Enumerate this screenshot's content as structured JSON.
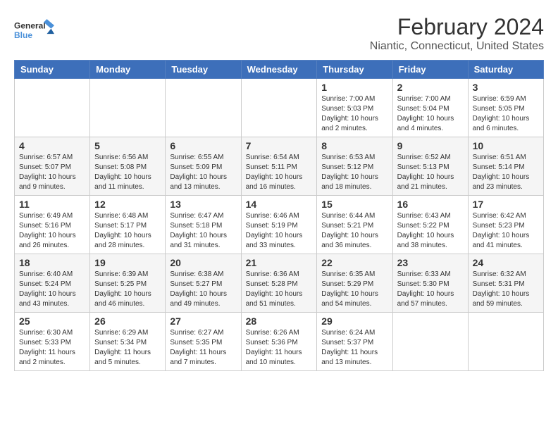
{
  "logo": {
    "line1": "General",
    "line2": "Blue"
  },
  "title": "February 2024",
  "subtitle": "Niantic, Connecticut, United States",
  "days_of_week": [
    "Sunday",
    "Monday",
    "Tuesday",
    "Wednesday",
    "Thursday",
    "Friday",
    "Saturday"
  ],
  "weeks": [
    [
      {
        "day": "",
        "info": ""
      },
      {
        "day": "",
        "info": ""
      },
      {
        "day": "",
        "info": ""
      },
      {
        "day": "",
        "info": ""
      },
      {
        "day": "1",
        "info": "Sunrise: 7:00 AM\nSunset: 5:03 PM\nDaylight: 10 hours\nand 2 minutes."
      },
      {
        "day": "2",
        "info": "Sunrise: 7:00 AM\nSunset: 5:04 PM\nDaylight: 10 hours\nand 4 minutes."
      },
      {
        "day": "3",
        "info": "Sunrise: 6:59 AM\nSunset: 5:05 PM\nDaylight: 10 hours\nand 6 minutes."
      }
    ],
    [
      {
        "day": "4",
        "info": "Sunrise: 6:57 AM\nSunset: 5:07 PM\nDaylight: 10 hours\nand 9 minutes."
      },
      {
        "day": "5",
        "info": "Sunrise: 6:56 AM\nSunset: 5:08 PM\nDaylight: 10 hours\nand 11 minutes."
      },
      {
        "day": "6",
        "info": "Sunrise: 6:55 AM\nSunset: 5:09 PM\nDaylight: 10 hours\nand 13 minutes."
      },
      {
        "day": "7",
        "info": "Sunrise: 6:54 AM\nSunset: 5:11 PM\nDaylight: 10 hours\nand 16 minutes."
      },
      {
        "day": "8",
        "info": "Sunrise: 6:53 AM\nSunset: 5:12 PM\nDaylight: 10 hours\nand 18 minutes."
      },
      {
        "day": "9",
        "info": "Sunrise: 6:52 AM\nSunset: 5:13 PM\nDaylight: 10 hours\nand 21 minutes."
      },
      {
        "day": "10",
        "info": "Sunrise: 6:51 AM\nSunset: 5:14 PM\nDaylight: 10 hours\nand 23 minutes."
      }
    ],
    [
      {
        "day": "11",
        "info": "Sunrise: 6:49 AM\nSunset: 5:16 PM\nDaylight: 10 hours\nand 26 minutes."
      },
      {
        "day": "12",
        "info": "Sunrise: 6:48 AM\nSunset: 5:17 PM\nDaylight: 10 hours\nand 28 minutes."
      },
      {
        "day": "13",
        "info": "Sunrise: 6:47 AM\nSunset: 5:18 PM\nDaylight: 10 hours\nand 31 minutes."
      },
      {
        "day": "14",
        "info": "Sunrise: 6:46 AM\nSunset: 5:19 PM\nDaylight: 10 hours\nand 33 minutes."
      },
      {
        "day": "15",
        "info": "Sunrise: 6:44 AM\nSunset: 5:21 PM\nDaylight: 10 hours\nand 36 minutes."
      },
      {
        "day": "16",
        "info": "Sunrise: 6:43 AM\nSunset: 5:22 PM\nDaylight: 10 hours\nand 38 minutes."
      },
      {
        "day": "17",
        "info": "Sunrise: 6:42 AM\nSunset: 5:23 PM\nDaylight: 10 hours\nand 41 minutes."
      }
    ],
    [
      {
        "day": "18",
        "info": "Sunrise: 6:40 AM\nSunset: 5:24 PM\nDaylight: 10 hours\nand 43 minutes."
      },
      {
        "day": "19",
        "info": "Sunrise: 6:39 AM\nSunset: 5:25 PM\nDaylight: 10 hours\nand 46 minutes."
      },
      {
        "day": "20",
        "info": "Sunrise: 6:38 AM\nSunset: 5:27 PM\nDaylight: 10 hours\nand 49 minutes."
      },
      {
        "day": "21",
        "info": "Sunrise: 6:36 AM\nSunset: 5:28 PM\nDaylight: 10 hours\nand 51 minutes."
      },
      {
        "day": "22",
        "info": "Sunrise: 6:35 AM\nSunset: 5:29 PM\nDaylight: 10 hours\nand 54 minutes."
      },
      {
        "day": "23",
        "info": "Sunrise: 6:33 AM\nSunset: 5:30 PM\nDaylight: 10 hours\nand 57 minutes."
      },
      {
        "day": "24",
        "info": "Sunrise: 6:32 AM\nSunset: 5:31 PM\nDaylight: 10 hours\nand 59 minutes."
      }
    ],
    [
      {
        "day": "25",
        "info": "Sunrise: 6:30 AM\nSunset: 5:33 PM\nDaylight: 11 hours\nand 2 minutes."
      },
      {
        "day": "26",
        "info": "Sunrise: 6:29 AM\nSunset: 5:34 PM\nDaylight: 11 hours\nand 5 minutes."
      },
      {
        "day": "27",
        "info": "Sunrise: 6:27 AM\nSunset: 5:35 PM\nDaylight: 11 hours\nand 7 minutes."
      },
      {
        "day": "28",
        "info": "Sunrise: 6:26 AM\nSunset: 5:36 PM\nDaylight: 11 hours\nand 10 minutes."
      },
      {
        "day": "29",
        "info": "Sunrise: 6:24 AM\nSunset: 5:37 PM\nDaylight: 11 hours\nand 13 minutes."
      },
      {
        "day": "",
        "info": ""
      },
      {
        "day": "",
        "info": ""
      }
    ]
  ]
}
